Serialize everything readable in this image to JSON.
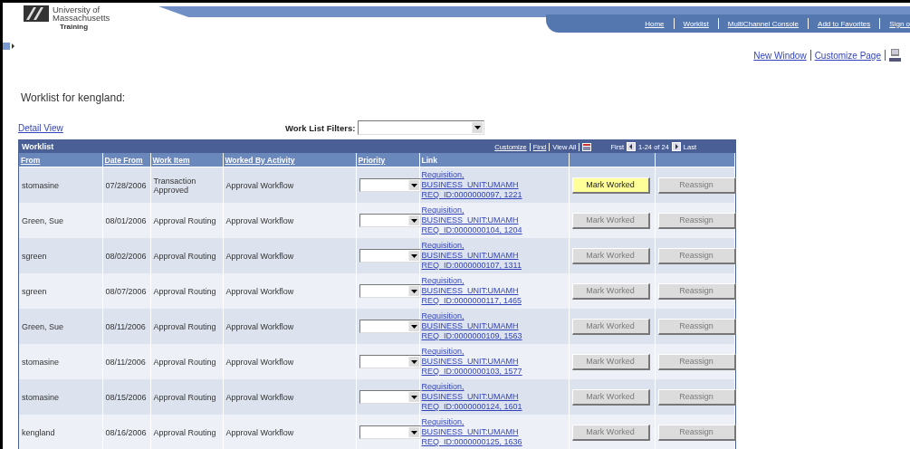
{
  "header": {
    "logo_lines": [
      "University of",
      "Massachusetts"
    ],
    "logo_sub": "Training"
  },
  "nav": [
    {
      "label": "Home"
    },
    {
      "label": "Worklist"
    },
    {
      "label": "MultiChannel Console"
    },
    {
      "label": "Add to Favorites"
    },
    {
      "label": "Sign o"
    }
  ],
  "page_links": [
    "New Window",
    "Customize Page"
  ],
  "title": "Worklist for kengland:",
  "detail_view": "Detail View",
  "filters": {
    "label": "Work List Filters:"
  },
  "grid": {
    "title": "Worklist",
    "toolbar": {
      "links": [
        "Customize",
        "Find"
      ],
      "view_all": "View All",
      "first": "First",
      "range": "1-24 of 24",
      "last": "Last"
    },
    "columns": [
      "From",
      "Date From",
      "Work Item",
      "Worked By Activity",
      "Priority",
      "Link"
    ],
    "rows": [
      {
        "from": "stomasine",
        "date": "07/28/2006",
        "item": "Transaction Approved",
        "activity": "Approval Workflow",
        "link": [
          "Requisition,",
          "BUSINESS_UNIT:UMAMH",
          "REQ_ID:0000000097, 1221"
        ],
        "mark": "Mark Worked",
        "mark_disabled": false,
        "reassign": "Reassign",
        "reassign_disabled": true
      },
      {
        "from": "Green, Sue",
        "date": "08/01/2006",
        "item": "Approval Routing",
        "activity": "Approval Workflow",
        "link": [
          "Requisition,",
          "BUSINESS_UNIT:UMAMH",
          "REQ_ID:0000000104, 1204"
        ],
        "mark": "Mark Worked",
        "mark_disabled": true,
        "reassign": "Reassign",
        "reassign_disabled": true
      },
      {
        "from": "sgreen",
        "date": "08/02/2006",
        "item": "Approval Routing",
        "activity": "Approval Workflow",
        "link": [
          "Requisition,",
          "BUSINESS_UNIT:UMAMH",
          "REQ_ID:0000000107, 1311"
        ],
        "mark": "Mark Worked",
        "mark_disabled": true,
        "reassign": "Reassign",
        "reassign_disabled": true
      },
      {
        "from": "sgreen",
        "date": "08/07/2006",
        "item": "Approval Routing",
        "activity": "Approval Workflow",
        "link": [
          "Requisition,",
          "BUSINESS_UNIT:UMAMH",
          "REQ_ID:0000000117, 1465"
        ],
        "mark": "Mark Worked",
        "mark_disabled": true,
        "reassign": "Reassign",
        "reassign_disabled": true
      },
      {
        "from": "Green, Sue",
        "date": "08/11/2006",
        "item": "Approval Routing",
        "activity": "Approval Workflow",
        "link": [
          "Requisition,",
          "BUSINESS_UNIT:UMAMH",
          "REQ_ID:0000000109, 1563"
        ],
        "mark": "Mark Worked",
        "mark_disabled": true,
        "reassign": "Reassign",
        "reassign_disabled": true
      },
      {
        "from": "stomasine",
        "date": "08/11/2006",
        "item": "Approval Routing",
        "activity": "Approval Workflow",
        "link": [
          "Requisition,",
          "BUSINESS_UNIT:UMAMH",
          "REQ_ID:0000000103, 1577"
        ],
        "mark": "Mark Worked",
        "mark_disabled": true,
        "reassign": "Reassign",
        "reassign_disabled": true
      },
      {
        "from": "stomasine",
        "date": "08/15/2006",
        "item": "Approval Routing",
        "activity": "Approval Workflow",
        "link": [
          "Requisition,",
          "BUSINESS_UNIT:UMAMH",
          "REQ_ID:0000000124, 1601"
        ],
        "mark": "Mark Worked",
        "mark_disabled": true,
        "reassign": "Reassign",
        "reassign_disabled": true
      },
      {
        "from": "kengland",
        "date": "08/16/2006",
        "item": "Approval Routing",
        "activity": "Approval Workflow",
        "link": [
          "Requisition,",
          "BUSINESS_UNIT:UMAMH",
          "REQ_ID:0000000125, 1636"
        ],
        "mark": "Mark Worked",
        "mark_disabled": true,
        "reassign": "Reassign",
        "reassign_disabled": true
      }
    ]
  }
}
